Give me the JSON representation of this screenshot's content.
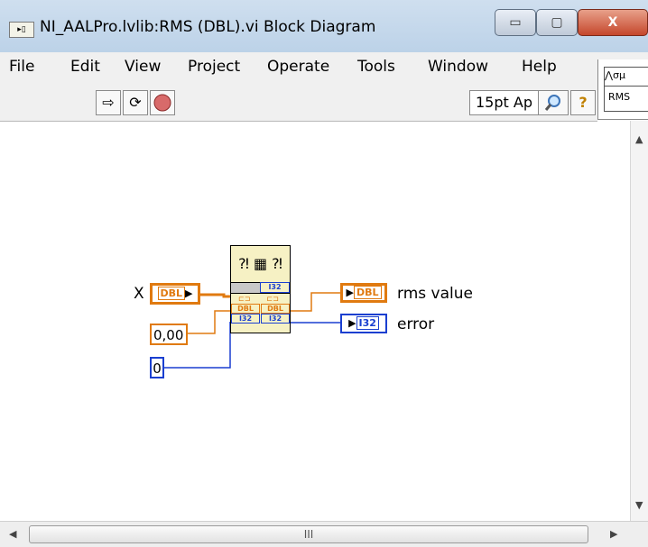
{
  "window": {
    "title": "NI_AALPro.lvlib:RMS (DBL).vi Block Diagram",
    "icon_name": "labview-vi-icon",
    "buttons": {
      "minimize": "▭",
      "maximize": "▢",
      "close": "X"
    }
  },
  "menu": [
    "File",
    "Edit",
    "View",
    "Project",
    "Operate",
    "Tools",
    "Window",
    "Help"
  ],
  "toolbar": {
    "run_icon": "⇨",
    "run_continuous_icon": "⟳",
    "abort_icon": "stop-circle-icon",
    "font_select": "15pt Ap",
    "search_icon": "magnifier-icon",
    "help_icon": "?"
  },
  "palette": {
    "top": "⋀σμ",
    "label": "RMS"
  },
  "diagram": {
    "input_x_label": "X",
    "input_x_type": "DBL",
    "constant_value": "0,00",
    "constant_int": "0",
    "subvi_pins": [
      "I32",
      "DBL",
      "DBL",
      "I32",
      "I32"
    ],
    "output_rms_type": "DBL",
    "output_rms_label": "rms value",
    "output_error_type": "I32",
    "output_error_label": "error"
  },
  "scrollbar": {
    "grip": "III"
  },
  "colors": {
    "dbl": "#e07a10",
    "i32": "#1a3fd0",
    "titlebar": "#c7daf0"
  }
}
